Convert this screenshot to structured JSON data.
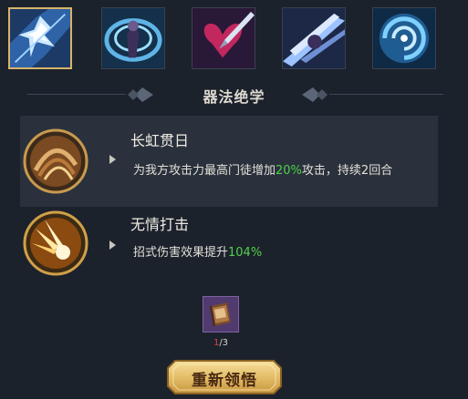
{
  "skills": [
    {
      "icon": "shattered-blade-skill-icon",
      "selected": true
    },
    {
      "icon": "whirlwind-warrior-skill-icon",
      "selected": false
    },
    {
      "icon": "piercing-heart-skill-icon",
      "selected": false
    },
    {
      "icon": "sword-rush-skill-icon",
      "selected": false
    },
    {
      "icon": "vortex-skill-icon",
      "selected": false
    }
  ],
  "section": {
    "title": "器法绝学"
  },
  "abilities": [
    {
      "name": "长虹贯日",
      "desc_prefix": "为我方攻击力最高门徒增加",
      "desc_value": "20%",
      "desc_suffix": "攻击，持续2回合",
      "icon": "rainbow-strike-icon"
    },
    {
      "name": "无情打击",
      "desc_prefix": "招式伤害效果提升",
      "desc_value": "104%",
      "desc_suffix": "",
      "icon": "ruthless-strike-icon"
    }
  ],
  "item": {
    "icon": "manual-book-icon",
    "have": "1",
    "need": "/3"
  },
  "button": {
    "label": "重新领悟"
  },
  "colors": {
    "highlight": "#4fd14a",
    "shortage": "#e04040",
    "gold": "#d7b46a"
  }
}
